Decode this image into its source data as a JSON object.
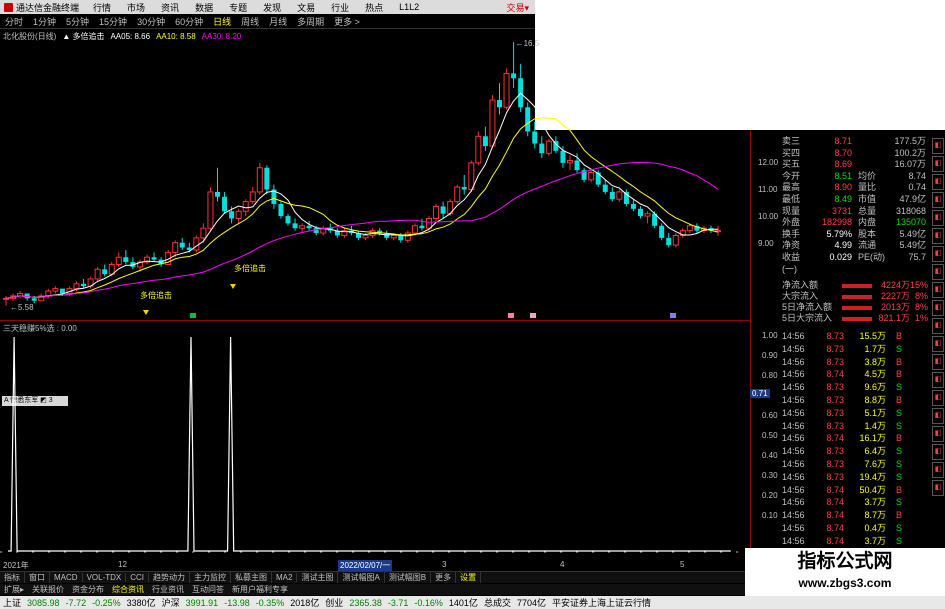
{
  "window": {
    "app_name": "通达信金融终端",
    "trade_label": "交易▾"
  },
  "menu": [
    "行情",
    "市场",
    "资讯",
    "数据",
    "专题",
    "发现",
    "文易",
    "行业",
    "热点",
    "L1L2"
  ],
  "periods": [
    "分时",
    "1分钟",
    "5分钟",
    "15分钟",
    "30分钟",
    "60分钟",
    "日线",
    "周线",
    "月线",
    "多周期",
    "更多 >"
  ],
  "period_active": "日线",
  "info": {
    "stock": "北化股份(日线)",
    "indicator": "▲ 多倍追击",
    "aa5": "AA05: 8.66",
    "aa10": "AA10: 8.58",
    "aa30": "AA30: 8.20"
  },
  "kline_annotations": {
    "high": "16.5",
    "low": "5.58",
    "signal_1": "多倍追击",
    "signal_2": "多倍追击"
  },
  "price_axis": [
    "12.00",
    "11.00",
    "10.00",
    "9.00"
  ],
  "indicator_label": "三天稳赚5%选 : 0.00",
  "indicator_box": "A 惊悉东军 ◩ 3",
  "indicator_axis": [
    "1.00",
    "0.90",
    "0.80",
    "0.70",
    "0.60",
    "0.50",
    "0.40",
    "0.30",
    "0.20",
    "0.10"
  ],
  "indicator_axis_hl": "0.71",
  "quote": {
    "rows": [
      {
        "l": "卖三",
        "v": "8.71",
        "l2": "",
        "v2": "177.5万"
      },
      {
        "l": "买四",
        "v": "8.70",
        "l2": "",
        "v2": "100.2万"
      },
      {
        "l": "买五",
        "v": "8.69",
        "l2": "",
        "v2": "16.07万"
      },
      {
        "l": "今开",
        "v": "8.51",
        "l2": "均价",
        "v2": "8.74"
      },
      {
        "l": "最高",
        "v": "8.90",
        "l2": "量比",
        "v2": "0.74"
      },
      {
        "l": "最低",
        "v": "8.49",
        "l2": "市值",
        "v2": "47.9亿"
      },
      {
        "l": "现量",
        "v": "3731",
        "l2": "总量",
        "v2": "318068"
      },
      {
        "l": "外盘",
        "v": "182998",
        "l2": "内盘",
        "v2": "135070"
      },
      {
        "l": "换手",
        "v": "5.79%",
        "l2": "股本",
        "v2": "5.49亿"
      },
      {
        "l": "净资",
        "v": "4.99",
        "l2": "流通",
        "v2": "5.49亿"
      },
      {
        "l": "收益(一)",
        "v": "0.029",
        "l2": "PE(动)",
        "v2": "75.7"
      }
    ]
  },
  "money_flow": [
    {
      "label": "净流入额",
      "value": "4224万",
      "pct": "15%"
    },
    {
      "label": "大宗流入",
      "value": "2227万",
      "pct": "8%"
    },
    {
      "label": "5日净流入额",
      "value": "2013万",
      "pct": "8%"
    },
    {
      "label": "5日大宗流入",
      "value": "821.1万",
      "pct": "1%"
    }
  ],
  "ticks": [
    {
      "t": "14:56",
      "p": "8.73",
      "v": "15.5万",
      "s": "B"
    },
    {
      "t": "14:56",
      "p": "8.73",
      "v": "1.7万",
      "s": "S"
    },
    {
      "t": "14:56",
      "p": "8.73",
      "v": "3.8万",
      "s": "B"
    },
    {
      "t": "14:56",
      "p": "8.74",
      "v": "4.5万",
      "s": "B"
    },
    {
      "t": "14:56",
      "p": "8.73",
      "v": "9.6万",
      "s": "S"
    },
    {
      "t": "14:56",
      "p": "8.73",
      "v": "8.8万",
      "s": "B"
    },
    {
      "t": "14:56",
      "p": "8.73",
      "v": "5.1万",
      "s": "S"
    },
    {
      "t": "14:56",
      "p": "8.73",
      "v": "1.4万",
      "s": "S"
    },
    {
      "t": "14:56",
      "p": "8.74",
      "v": "16.1万",
      "s": "B"
    },
    {
      "t": "14:56",
      "p": "8.73",
      "v": "6.4万",
      "s": "S"
    },
    {
      "t": "14:56",
      "p": "8.73",
      "v": "7.6万",
      "s": "S"
    },
    {
      "t": "14:56",
      "p": "8.73",
      "v": "19.4万",
      "s": "S"
    },
    {
      "t": "14:56",
      "p": "8.74",
      "v": "50.4万",
      "s": "B"
    },
    {
      "t": "14:56",
      "p": "8.74",
      "v": "3.7万",
      "s": "S"
    },
    {
      "t": "14:56",
      "p": "8.74",
      "v": "8.7万",
      "s": "B"
    },
    {
      "t": "14:56",
      "p": "8.74",
      "v": "0.4万",
      "s": "S"
    },
    {
      "t": "14:56",
      "p": "8.74",
      "v": "3.7万",
      "s": "S"
    },
    {
      "t": "14:56",
      "p": "8.73",
      "v": "3.0万",
      "s": "B"
    }
  ],
  "dates": {
    "start": "2021年",
    "d1": "12",
    "sel": "2022/02/07/一",
    "d2": "3",
    "d3": "4",
    "d4": "5"
  },
  "tabs1": [
    "指标",
    "窗口",
    "MACD",
    "VOL-TDX",
    "CCI",
    "趋势动力",
    "主力监控",
    "私募主图",
    "MA2",
    "测试主图",
    "测试幅图A",
    "测试幅图B",
    "更多",
    "设置"
  ],
  "tabs2": [
    "扩展▸",
    "关联报价",
    "资金分布",
    "综合资讯",
    "行业资讯",
    "互动问答",
    "新用户福利专享"
  ],
  "tabs2_active": "综合资讯",
  "watermark": {
    "title": "指标公式网",
    "url": "www.zbgs3.com"
  },
  "status": {
    "sh_label": "上证",
    "sh_val": "3085.98",
    "sh_chg": "-7.72",
    "sh_pct": "-0.25%",
    "sh_amt": "3380亿",
    "sz_label": "沪深",
    "sz_val": "3991.91",
    "sz_chg": "-13.98",
    "sz_pct": "-0.35%",
    "sz_amt": "2018亿",
    "cy_label": "创业",
    "cy_val": "2365.38",
    "cy_chg": "-3.71",
    "cy_pct": "-0.16%",
    "cy_amt": "1401亿",
    "total_label": "总成交",
    "total_val": "7704亿",
    "broker": "平安证券上海上证云行情"
  },
  "chart_data": [
    {
      "type": "candlestick",
      "title": "北化股份(日线)",
      "series_names": [
        "AA05",
        "AA10",
        "AA30"
      ],
      "current": {
        "AA05": 8.66,
        "AA10": 8.58,
        "AA30": 8.2
      },
      "ylim": [
        5.5,
        16.5
      ],
      "candles": [
        [
          5.9,
          6.0,
          5.6,
          5.9
        ],
        [
          5.9,
          6.1,
          5.8,
          6.0
        ],
        [
          6.0,
          6.2,
          5.9,
          6.1
        ],
        [
          6.1,
          6.1,
          5.8,
          5.9
        ],
        [
          5.9,
          6.0,
          5.7,
          5.8
        ],
        [
          5.8,
          6.1,
          5.8,
          6.0
        ],
        [
          6.0,
          6.3,
          5.9,
          6.2
        ],
        [
          6.2,
          6.4,
          6.1,
          6.3
        ],
        [
          6.3,
          6.3,
          6.0,
          6.1
        ],
        [
          6.1,
          6.4,
          6.0,
          6.3
        ],
        [
          6.3,
          6.6,
          6.2,
          6.5
        ],
        [
          6.5,
          6.7,
          6.3,
          6.4
        ],
        [
          6.4,
          6.8,
          6.3,
          6.7
        ],
        [
          6.7,
          7.2,
          6.6,
          7.1
        ],
        [
          7.1,
          7.3,
          6.8,
          6.9
        ],
        [
          6.9,
          7.4,
          6.8,
          7.3
        ],
        [
          7.3,
          7.8,
          7.2,
          7.6
        ],
        [
          7.6,
          7.9,
          7.3,
          7.4
        ],
        [
          7.4,
          7.6,
          7.1,
          7.2
        ],
        [
          7.2,
          7.5,
          7.0,
          7.4
        ],
        [
          7.4,
          7.7,
          7.3,
          7.6
        ],
        [
          7.6,
          7.8,
          7.4,
          7.5
        ],
        [
          7.5,
          7.6,
          7.2,
          7.3
        ],
        [
          7.3,
          7.9,
          7.3,
          7.8
        ],
        [
          7.8,
          8.3,
          7.6,
          8.2
        ],
        [
          8.2,
          8.4,
          7.9,
          8.0
        ],
        [
          8.0,
          8.2,
          7.8,
          7.9
        ],
        [
          7.9,
          8.5,
          7.8,
          8.4
        ],
        [
          8.4,
          9.0,
          8.2,
          8.8
        ],
        [
          8.8,
          10.5,
          8.7,
          10.3
        ],
        [
          10.3,
          11.3,
          9.9,
          10.1
        ],
        [
          10.1,
          10.3,
          9.4,
          9.5
        ],
        [
          9.5,
          9.7,
          9.0,
          9.2
        ],
        [
          9.2,
          9.6,
          9.0,
          9.5
        ],
        [
          9.5,
          10.0,
          9.3,
          9.9
        ],
        [
          9.9,
          10.5,
          9.8,
          10.3
        ],
        [
          10.3,
          11.5,
          10.2,
          11.3
        ],
        [
          11.3,
          11.4,
          10.2,
          10.4
        ],
        [
          10.4,
          10.6,
          9.6,
          9.8
        ],
        [
          9.8,
          9.9,
          9.2,
          9.3
        ],
        [
          9.3,
          9.4,
          8.9,
          9.0
        ],
        [
          9.0,
          9.2,
          8.7,
          8.8
        ],
        [
          8.8,
          9.0,
          8.6,
          8.9
        ],
        [
          8.9,
          9.1,
          8.7,
          8.8
        ],
        [
          8.8,
          8.9,
          8.5,
          8.6
        ],
        [
          8.6,
          8.9,
          8.5,
          8.8
        ],
        [
          8.8,
          9.0,
          8.6,
          8.7
        ],
        [
          8.7,
          8.8,
          8.4,
          8.5
        ],
        [
          8.5,
          8.8,
          8.4,
          8.7
        ],
        [
          8.7,
          8.9,
          8.5,
          8.6
        ],
        [
          8.6,
          8.7,
          8.3,
          8.4
        ],
        [
          8.4,
          8.6,
          8.3,
          8.5
        ],
        [
          8.5,
          8.8,
          8.4,
          8.7
        ],
        [
          8.7,
          8.8,
          8.5,
          8.6
        ],
        [
          8.6,
          8.7,
          8.3,
          8.4
        ],
        [
          8.4,
          8.6,
          8.3,
          8.5
        ],
        [
          8.5,
          8.6,
          8.2,
          8.3
        ],
        [
          8.3,
          8.7,
          8.2,
          8.6
        ],
        [
          8.6,
          9.0,
          8.5,
          8.9
        ],
        [
          8.9,
          9.2,
          8.7,
          8.8
        ],
        [
          8.8,
          9.3,
          8.7,
          9.2
        ],
        [
          9.2,
          9.8,
          9.1,
          9.7
        ],
        [
          9.7,
          9.9,
          9.2,
          9.4
        ],
        [
          9.4,
          10.0,
          9.3,
          9.9
        ],
        [
          9.9,
          10.6,
          9.8,
          10.5
        ],
        [
          10.5,
          11.0,
          10.2,
          10.4
        ],
        [
          10.4,
          11.6,
          10.3,
          11.5
        ],
        [
          11.5,
          12.8,
          11.4,
          12.6
        ],
        [
          12.6,
          13.0,
          12.0,
          12.2
        ],
        [
          12.2,
          14.3,
          12.1,
          14.1
        ],
        [
          14.1,
          14.8,
          13.5,
          13.8
        ],
        [
          13.8,
          15.4,
          13.7,
          15.2
        ],
        [
          15.2,
          16.5,
          14.6,
          15.0
        ],
        [
          15.0,
          15.6,
          13.6,
          13.8
        ],
        [
          13.8,
          14.0,
          12.6,
          12.8
        ],
        [
          12.8,
          13.2,
          12.1,
          12.3
        ],
        [
          12.3,
          12.6,
          11.7,
          11.9
        ],
        [
          11.9,
          12.5,
          11.8,
          12.4
        ],
        [
          12.4,
          12.6,
          11.9,
          12.0
        ],
        [
          12.0,
          12.2,
          11.3,
          11.5
        ],
        [
          11.5,
          11.8,
          11.2,
          11.6
        ],
        [
          11.6,
          11.9,
          11.1,
          11.2
        ],
        [
          11.2,
          11.3,
          10.7,
          10.8
        ],
        [
          10.8,
          11.2,
          10.7,
          11.1
        ],
        [
          11.1,
          11.2,
          10.5,
          10.6
        ],
        [
          10.6,
          10.8,
          10.2,
          10.3
        ],
        [
          10.3,
          10.5,
          9.9,
          10.0
        ],
        [
          10.0,
          10.4,
          9.9,
          10.3
        ],
        [
          10.3,
          10.4,
          9.7,
          9.8
        ],
        [
          9.8,
          10.0,
          9.5,
          9.6
        ],
        [
          9.6,
          9.7,
          9.2,
          9.3
        ],
        [
          9.3,
          9.5,
          9.0,
          9.4
        ],
        [
          9.4,
          9.5,
          8.8,
          8.9
        ],
        [
          8.9,
          9.0,
          8.3,
          8.4
        ],
        [
          8.4,
          8.6,
          8.0,
          8.1
        ],
        [
          8.1,
          8.6,
          8.0,
          8.5
        ],
        [
          8.5,
          8.8,
          8.4,
          8.7
        ],
        [
          8.7,
          9.0,
          8.6,
          8.9
        ],
        [
          8.9,
          9.0,
          8.6,
          8.7
        ],
        [
          8.7,
          8.9,
          8.6,
          8.8
        ],
        [
          8.8,
          8.9,
          8.6,
          8.7
        ],
        [
          8.7,
          8.9,
          8.5,
          8.7
        ]
      ]
    },
    {
      "type": "line",
      "title": "三天稳赚5%选",
      "ylim": [
        0,
        1
      ],
      "spikes": [
        2,
        60,
        73
      ],
      "bar_count": 238
    }
  ]
}
